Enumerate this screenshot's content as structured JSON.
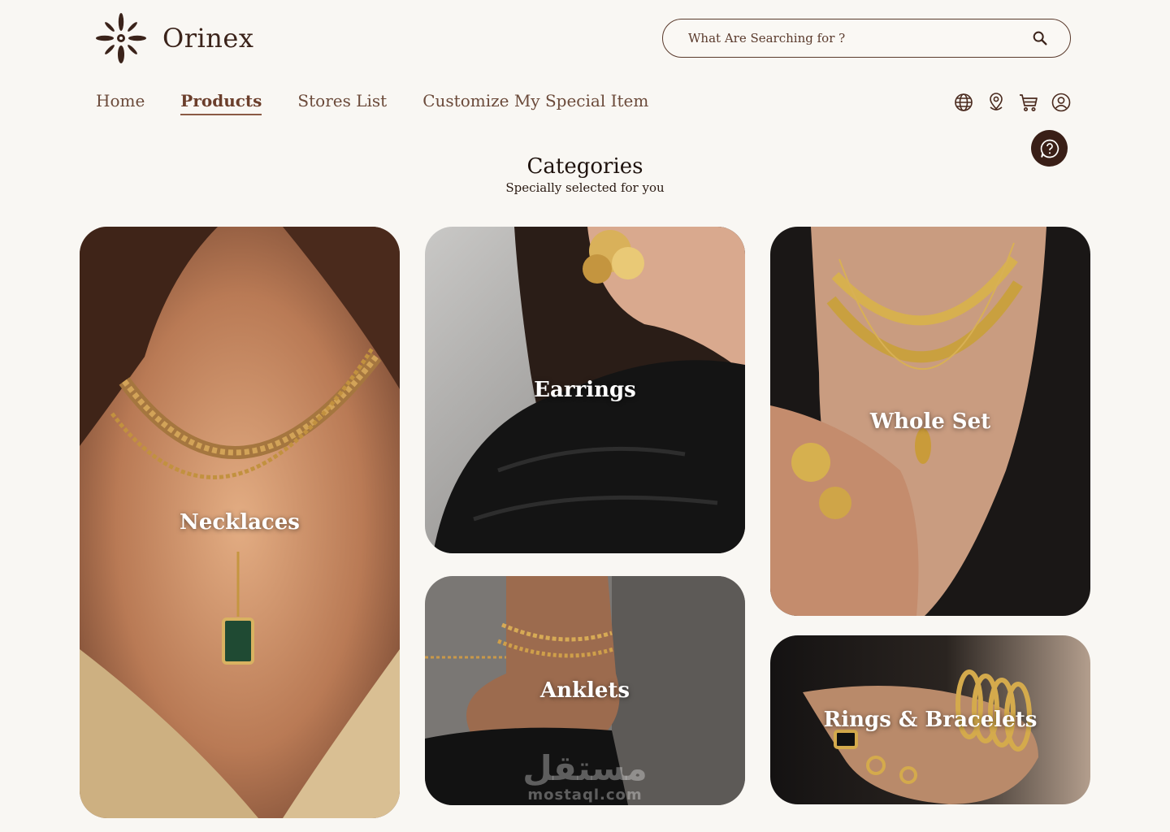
{
  "brand": {
    "name": "Orinex"
  },
  "search": {
    "placeholder": "What Are Searching for ?"
  },
  "nav": {
    "items": [
      {
        "label": "Home"
      },
      {
        "label": "Products",
        "active": true
      },
      {
        "label": "Stores List"
      },
      {
        "label": "Customize My Special Item"
      }
    ]
  },
  "header_icons": [
    "globe-icon",
    "location-pin-icon",
    "cart-icon",
    "user-icon"
  ],
  "help": {
    "icon": "question-chat-icon"
  },
  "categories": {
    "title": "Categories",
    "subtitle": "Specially selected for you",
    "items": [
      {
        "label": "Necklaces"
      },
      {
        "label": "Earrings"
      },
      {
        "label": "Anklets"
      },
      {
        "label": "Whole Set"
      },
      {
        "label": "Rings & Bracelets"
      }
    ]
  },
  "watermark": {
    "arabic": "مستقل",
    "latin": "mostaql.com"
  },
  "colors": {
    "background": "#f9f7f3",
    "brand_dark": "#3a1f17",
    "nav_text": "#6b4a3a",
    "active_underline": "#8a5a44"
  }
}
